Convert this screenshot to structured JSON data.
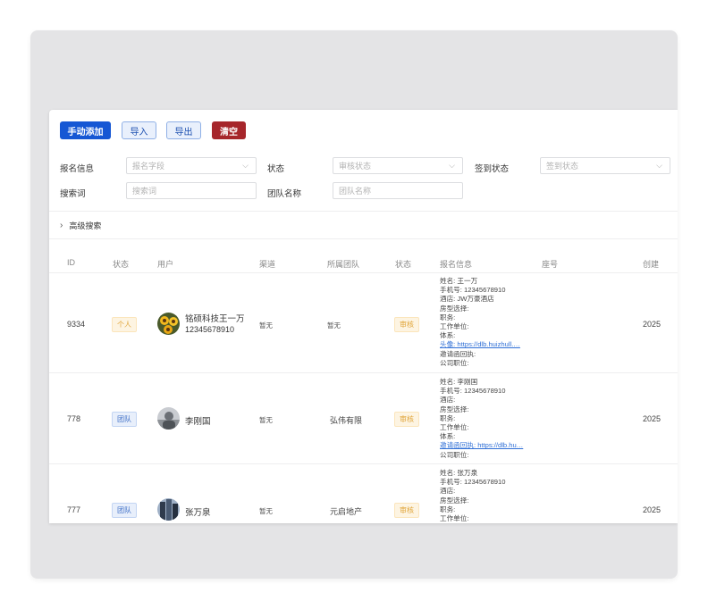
{
  "toolbar": {
    "add_label": "手动添加",
    "import_label": "导入",
    "export_label": "导出",
    "clear_label": "清空"
  },
  "filters": {
    "signup_info_label": "报名信息",
    "signup_field_placeholder": "报名字段",
    "status_label": "状态",
    "review_status_placeholder": "审核状态",
    "checkin_status_label": "签到状态",
    "checkin_status_placeholder": "签到状态",
    "keyword_label": "搜索词",
    "keyword_placeholder": "搜索词",
    "team_name_label": "团队名称",
    "team_name_placeholder": "团队名称"
  },
  "advanced_search": "高级搜索",
  "table": {
    "headers": [
      "ID",
      "状态",
      "用户",
      "渠道",
      "所属团队",
      "状态",
      "报名信息",
      "座号",
      "创建"
    ],
    "rows": [
      {
        "id": "9334",
        "type": "个人",
        "user_name": "铭硕科技王一万",
        "user_phone": "12345678910",
        "channel": "暂无",
        "team": "暂无",
        "review": "审核",
        "info": [
          "姓名: 王一万",
          "手机号: 12345678910",
          "酒店: JW万豪酒店",
          "房型选择:",
          "职务:",
          "工作单位:",
          "体系:"
        ],
        "info_link": "头像: https://dlb.huizhull.…",
        "info_after": [
          "邀请函回执:",
          "公司职位:"
        ],
        "created": "2025"
      },
      {
        "id": "778",
        "type": "团队",
        "user_name": "李刚国",
        "user_phone": "",
        "channel": "暂无",
        "team": "弘伟有限",
        "review": "审核",
        "info": [
          "姓名: 李刚国",
          "手机号: 12345678910",
          "酒店:",
          "房型选择:",
          "职务:",
          "工作单位:",
          "体系:"
        ],
        "info_link": "邀请函回执: https://dlb.hu…",
        "info_after": [
          "公司职位:"
        ],
        "created": "2025"
      },
      {
        "id": "777",
        "type": "团队",
        "user_name": "张万泉",
        "user_phone": "",
        "channel": "暂无",
        "team": "元启地产",
        "review": "审核",
        "info": [
          "姓名: 张万泉",
          "手机号: 12345678910",
          "酒店:",
          "房型选择:",
          "职务:",
          "工作单位:"
        ],
        "info_link": "",
        "info_after": [],
        "created": "2025"
      }
    ]
  },
  "colors": {
    "primary": "#1657d4",
    "danger": "#a6262b",
    "link": "#2f6fd6",
    "tag_person": "#e0a53a",
    "tag_team": "#3a6cc6"
  }
}
